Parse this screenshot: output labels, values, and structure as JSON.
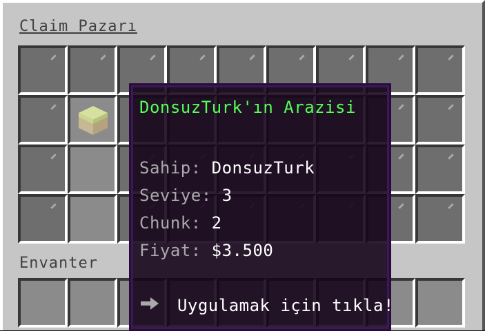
{
  "window": {
    "title": "Claim Pazarı",
    "inventory_title": "Envanter"
  },
  "chest_grid": {
    "rows": 4,
    "cols": 9,
    "filled_slot": {
      "row": 1,
      "col": 1,
      "item": "grass-block-icon"
    },
    "filler_item": "gray-glass-pane-icon"
  },
  "tooltip": {
    "title": "DonsuzTurk'ın Arazisi",
    "owner_label": "Sahip:",
    "owner_value": "DonsuzTurk",
    "level_label": "Seviye:",
    "level_value": "3",
    "chunk_label": "Chunk:",
    "chunk_value": "2",
    "price_label": "Fiyat:",
    "price_value": "$3.500",
    "action_icon": "arrow-right-icon",
    "action_text": "Uygulamak için tıkla!"
  },
  "colors": {
    "title_green": "#55ff55",
    "label_gray": "#aaaaaa",
    "value_white": "#ffffff",
    "tooltip_bg": "#16061c"
  }
}
